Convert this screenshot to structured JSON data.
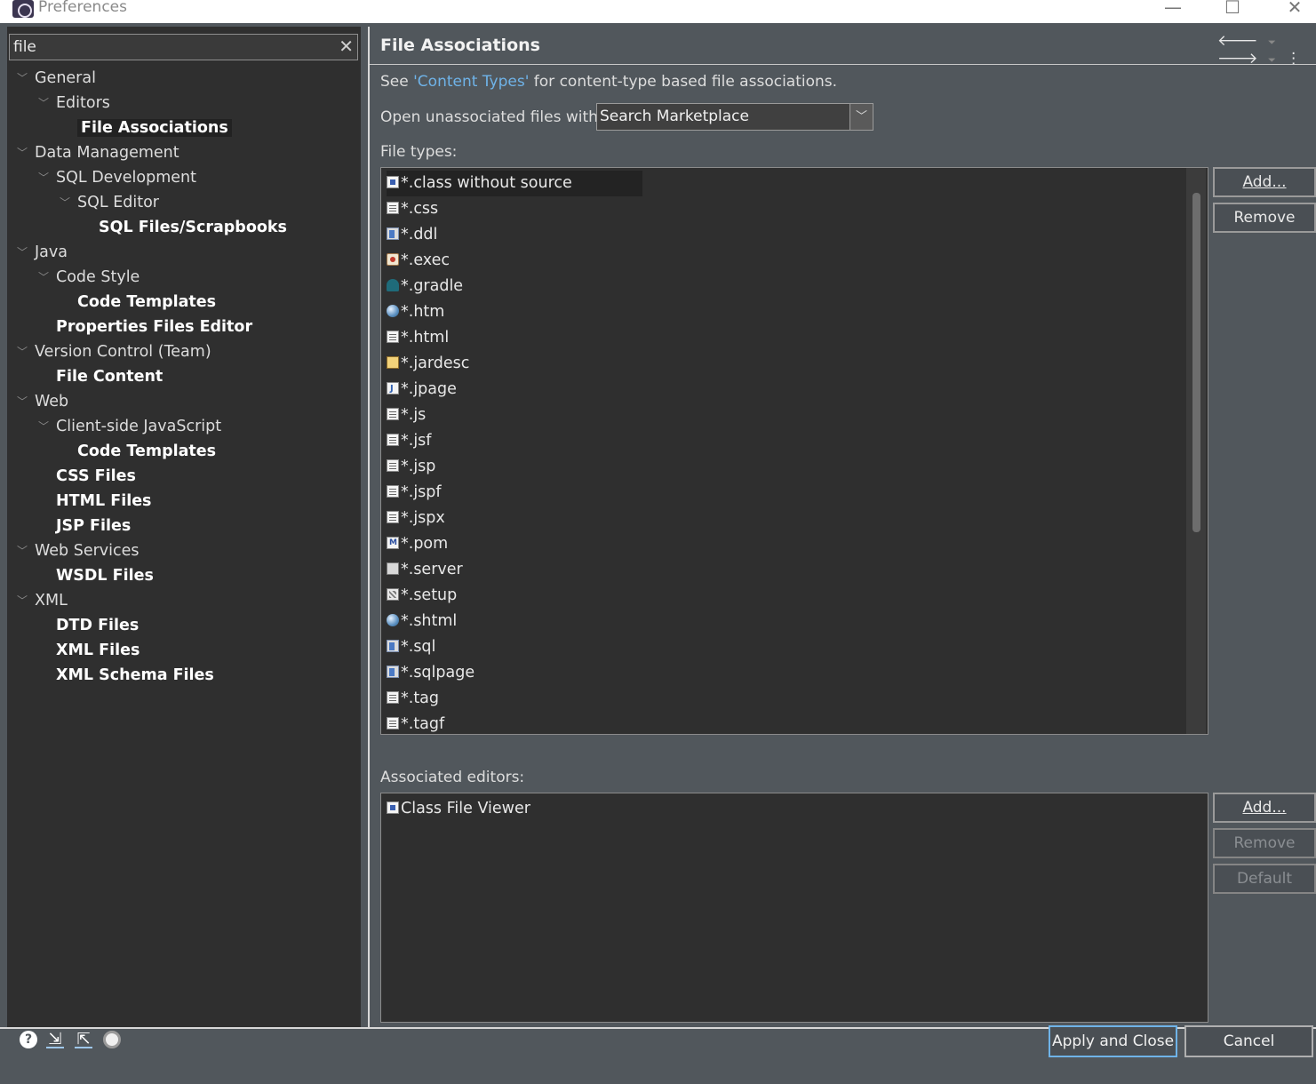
{
  "window": {
    "title": "Preferences",
    "minimize_glyph": "—",
    "maximize_glyph": "☐",
    "close_glyph": "✕"
  },
  "filter": {
    "value": "file",
    "clear_glyph": "✕"
  },
  "tree": [
    {
      "label": "General",
      "level": 0,
      "expanded": true,
      "bold": false
    },
    {
      "label": "Editors",
      "level": 1,
      "expanded": true,
      "bold": false
    },
    {
      "label": "File Associations",
      "level": 2,
      "expanded": false,
      "bold": true,
      "selected": true
    },
    {
      "label": "Data Management",
      "level": 0,
      "expanded": true,
      "bold": false
    },
    {
      "label": "SQL Development",
      "level": 1,
      "expanded": true,
      "bold": false
    },
    {
      "label": "SQL Editor",
      "level": 2,
      "expanded": true,
      "bold": false
    },
    {
      "label": "SQL Files/Scrapbooks",
      "level": 3,
      "expanded": false,
      "bold": true
    },
    {
      "label": "Java",
      "level": 0,
      "expanded": true,
      "bold": false
    },
    {
      "label": "Code Style",
      "level": 1,
      "expanded": true,
      "bold": false
    },
    {
      "label": "Code Templates",
      "level": 2,
      "expanded": false,
      "bold": true
    },
    {
      "label": "Properties Files Editor",
      "level": 1,
      "expanded": false,
      "bold": true
    },
    {
      "label": "Version Control (Team)",
      "level": 0,
      "expanded": true,
      "bold": false
    },
    {
      "label": "File Content",
      "level": 1,
      "expanded": false,
      "bold": true
    },
    {
      "label": "Web",
      "level": 0,
      "expanded": true,
      "bold": false
    },
    {
      "label": "Client-side JavaScript",
      "level": 1,
      "expanded": true,
      "bold": false
    },
    {
      "label": "Code Templates",
      "level": 2,
      "expanded": false,
      "bold": true
    },
    {
      "label": "CSS Files",
      "level": 1,
      "expanded": false,
      "bold": true
    },
    {
      "label": "HTML Files",
      "level": 1,
      "expanded": false,
      "bold": true
    },
    {
      "label": "JSP Files",
      "level": 1,
      "expanded": false,
      "bold": true
    },
    {
      "label": "Web Services",
      "level": 0,
      "expanded": true,
      "bold": false
    },
    {
      "label": "WSDL Files",
      "level": 1,
      "expanded": false,
      "bold": true
    },
    {
      "label": "XML",
      "level": 0,
      "expanded": true,
      "bold": false
    },
    {
      "label": "DTD Files",
      "level": 1,
      "expanded": false,
      "bold": true
    },
    {
      "label": "XML Files",
      "level": 1,
      "expanded": false,
      "bold": true
    },
    {
      "label": "XML Schema Files",
      "level": 1,
      "expanded": false,
      "bold": true
    }
  ],
  "page": {
    "title": "File Associations",
    "nav": {
      "back": "🡐",
      "back_menu": "⏷",
      "forward": "🡒",
      "forward_menu": "⏷",
      "menu": "⋮"
    },
    "see_prefix": "See ",
    "see_link": "'Content Types'",
    "see_suffix": " for content-type based file associations.",
    "open_label": "Open unassociated files with:",
    "open_value": "Search Marketplace",
    "open_arrow": "﹀",
    "file_types_label": "File types:",
    "file_types": [
      {
        "label": "*.class without source",
        "icon": "class"
      },
      {
        "label": "*.css",
        "icon": "doc"
      },
      {
        "label": "*.ddl",
        "icon": "db"
      },
      {
        "label": "*.exec",
        "icon": "gear"
      },
      {
        "label": "*.gradle",
        "icon": "cloud"
      },
      {
        "label": "*.htm",
        "icon": "globe"
      },
      {
        "label": "*.html",
        "icon": "doc"
      },
      {
        "label": "*.jardesc",
        "icon": "jar"
      },
      {
        "label": "*.jpage",
        "icon": "j"
      },
      {
        "label": "*.js",
        "icon": "doc"
      },
      {
        "label": "*.jsf",
        "icon": "doc"
      },
      {
        "label": "*.jsp",
        "icon": "doc"
      },
      {
        "label": "*.jspf",
        "icon": "doc"
      },
      {
        "label": "*.jspx",
        "icon": "doc"
      },
      {
        "label": "*.pom",
        "icon": "m"
      },
      {
        "label": "*.server",
        "icon": "server"
      },
      {
        "label": "*.setup",
        "icon": "setup"
      },
      {
        "label": "*.shtml",
        "icon": "globe"
      },
      {
        "label": "*.sql",
        "icon": "db"
      },
      {
        "label": "*.sqlpage",
        "icon": "db"
      },
      {
        "label": "*.tag",
        "icon": "doc"
      },
      {
        "label": "*.tagf",
        "icon": "doc"
      }
    ],
    "types_add": "Add...",
    "types_remove": "Remove",
    "assoc_label": "Associated editors:",
    "assoc_editors": [
      {
        "label": "Class File Viewer",
        "icon": "class"
      }
    ],
    "assoc_add": "Add...",
    "assoc_remove": "Remove",
    "assoc_default": "Default"
  },
  "footer": {
    "help_glyph": "?",
    "apply_close": "Apply and Close",
    "cancel": "Cancel"
  },
  "colors": {
    "background": "#51575c",
    "panel": "#2f2f2f",
    "link": "#6fb3e8",
    "default_button_border": "#6fb3e8"
  }
}
